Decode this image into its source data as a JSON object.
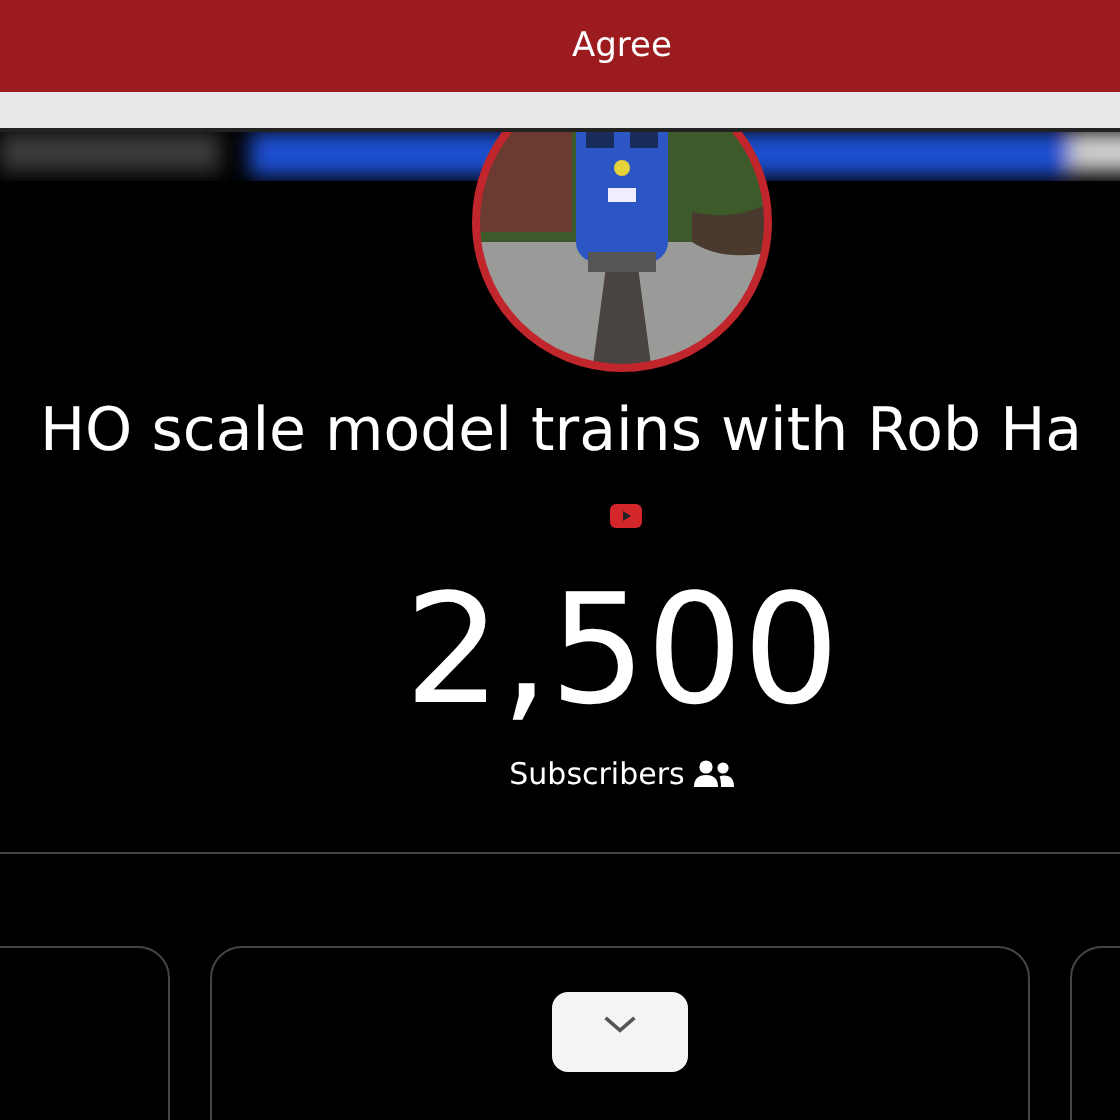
{
  "top_bar": {
    "button": "Agree"
  },
  "channel": {
    "title": "HO scale model trains with Rob Ha",
    "platform_icon": {
      "kind": "youtube"
    },
    "subscriber_count": "2,500",
    "subscriber_label": "Subscribers"
  },
  "cards": [
    {
      "kind": "plain"
    },
    {
      "kind": "toggle"
    },
    {
      "kind": "plain"
    }
  ]
}
